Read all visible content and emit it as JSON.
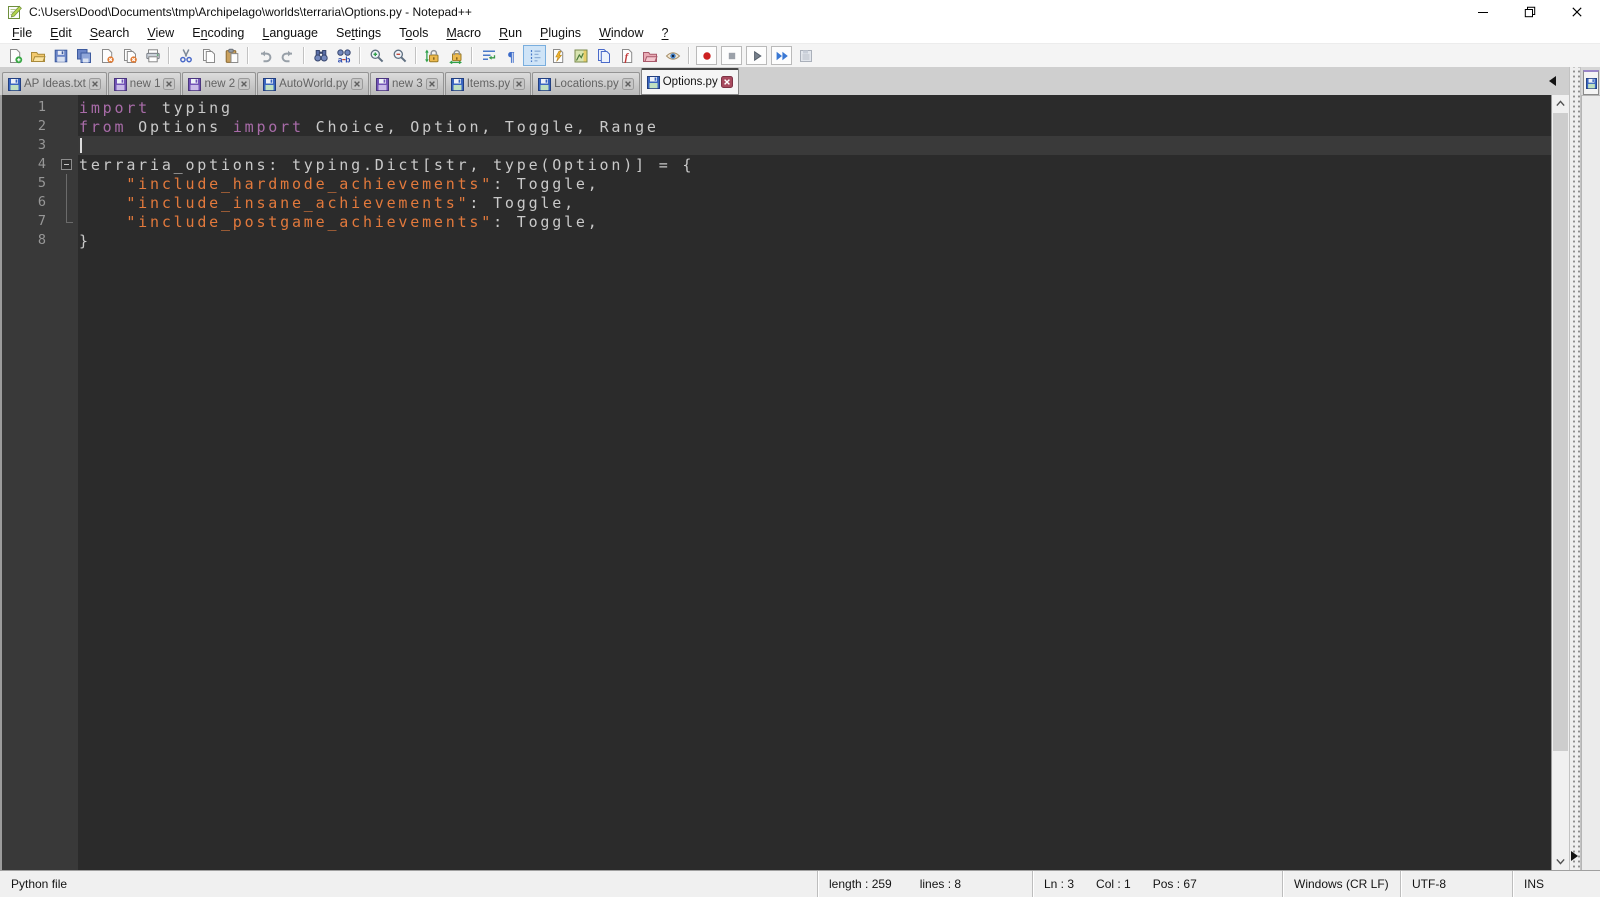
{
  "window": {
    "title": "C:\\Users\\Dood\\Documents\\tmp\\Archipelago\\worlds\\terraria\\Options.py - Notepad++"
  },
  "menu": {
    "items": [
      {
        "label": "File",
        "mnemonic": 0
      },
      {
        "label": "Edit",
        "mnemonic": 0
      },
      {
        "label": "Search",
        "mnemonic": 0
      },
      {
        "label": "View",
        "mnemonic": 0
      },
      {
        "label": "Encoding",
        "mnemonic": 1
      },
      {
        "label": "Language",
        "mnemonic": 0
      },
      {
        "label": "Settings",
        "mnemonic": 2
      },
      {
        "label": "Tools",
        "mnemonic": 1
      },
      {
        "label": "Macro",
        "mnemonic": 0
      },
      {
        "label": "Run",
        "mnemonic": 0
      },
      {
        "label": "Plugins",
        "mnemonic": 0
      },
      {
        "label": "Window",
        "mnemonic": 0
      },
      {
        "label": "?",
        "mnemonic": 0
      }
    ]
  },
  "toolbar": {
    "groups": [
      [
        {
          "name": "new-file"
        },
        {
          "name": "open"
        },
        {
          "name": "save"
        },
        {
          "name": "save-all"
        },
        {
          "name": "close"
        },
        {
          "name": "close-all"
        },
        {
          "name": "print"
        }
      ],
      [
        {
          "name": "cut"
        },
        {
          "name": "copy"
        },
        {
          "name": "paste"
        }
      ],
      [
        {
          "name": "undo"
        },
        {
          "name": "redo"
        }
      ],
      [
        {
          "name": "find"
        },
        {
          "name": "replace"
        }
      ],
      [
        {
          "name": "zoom-in"
        },
        {
          "name": "zoom-out"
        }
      ],
      [
        {
          "name": "sync-vertical-scroll"
        },
        {
          "name": "sync-horizontal-scroll"
        }
      ],
      [
        {
          "name": "word-wrap"
        },
        {
          "name": "show-all-characters"
        },
        {
          "name": "show-indent-guide",
          "active": true
        },
        {
          "name": "define-language"
        },
        {
          "name": "document-map"
        },
        {
          "name": "document-list"
        },
        {
          "name": "function-list"
        },
        {
          "name": "folder-as-workspace"
        },
        {
          "name": "monitoring"
        }
      ],
      [
        {
          "name": "macro-record",
          "boxed": true
        },
        {
          "name": "macro-stop",
          "boxed": true
        },
        {
          "name": "macro-playback",
          "boxed": true
        },
        {
          "name": "macro-run-multiple",
          "boxed": true
        },
        {
          "name": "macro-save"
        }
      ]
    ]
  },
  "tabs": {
    "items": [
      {
        "label": "AP Ideas.txt",
        "state": "saved",
        "active": false
      },
      {
        "label": "new 1",
        "state": "modified",
        "active": false
      },
      {
        "label": "new 2",
        "state": "modified",
        "active": false
      },
      {
        "label": "AutoWorld.py",
        "state": "saved",
        "active": false
      },
      {
        "label": "new 3",
        "state": "modified",
        "active": false
      },
      {
        "label": "Items.py",
        "state": "saved",
        "active": false
      },
      {
        "label": "Locations.py",
        "state": "saved",
        "active": false
      },
      {
        "label": "Options.py",
        "state": "saved",
        "active": true
      }
    ]
  },
  "editor": {
    "language": "Python",
    "caret_line": 3,
    "caret_col": 1,
    "current_line": 3,
    "lines": [
      {
        "num": 1,
        "fold": "",
        "tokens": [
          {
            "text": "import",
            "type": "keyword"
          },
          {
            "text": " typing",
            "type": "default"
          }
        ]
      },
      {
        "num": 2,
        "fold": "",
        "tokens": [
          {
            "text": "from",
            "type": "keyword"
          },
          {
            "text": " Options ",
            "type": "default"
          },
          {
            "text": "import",
            "type": "keyword"
          },
          {
            "text": " Choice, Option, Toggle, Range",
            "type": "default"
          }
        ]
      },
      {
        "num": 3,
        "fold": "",
        "tokens": []
      },
      {
        "num": 4,
        "fold": "collapse-box",
        "tokens": [
          {
            "text": "terraria_options: typing.Dict[str, type(Option)] = {",
            "type": "default"
          }
        ]
      },
      {
        "num": 5,
        "fold": "line",
        "tokens": [
          {
            "text": "    ",
            "type": "default"
          },
          {
            "text": "\"include_hardmode_achievements\"",
            "type": "string"
          },
          {
            "text": ": Toggle,",
            "type": "default"
          }
        ]
      },
      {
        "num": 6,
        "fold": "line",
        "tokens": [
          {
            "text": "    ",
            "type": "default"
          },
          {
            "text": "\"include_insane_achievements\"",
            "type": "string"
          },
          {
            "text": ": Toggle,",
            "type": "default"
          }
        ]
      },
      {
        "num": 7,
        "fold": "corner",
        "tokens": [
          {
            "text": "    ",
            "type": "default"
          },
          {
            "text": "\"include_postgame_achievements\"",
            "type": "string"
          },
          {
            "text": ": Toggle,",
            "type": "default"
          }
        ]
      },
      {
        "num": 8,
        "fold": "",
        "tokens": [
          {
            "text": "}",
            "type": "default"
          }
        ]
      }
    ]
  },
  "second_view": {
    "tab_icon_state": "saved"
  },
  "status": {
    "doc_type": "Python file",
    "length": "length : 259",
    "lines": "lines : 8",
    "ln": "Ln : 3",
    "col": "Col : 1",
    "pos": "Pos : 67",
    "eol": "Windows (CR LF)",
    "encoding": "UTF-8",
    "typing_mode": "INS"
  },
  "colors": {
    "keyword": "#a86ba8",
    "string": "#e2793c",
    "text": "#c9c9c9",
    "editor_bg": "#2b2b2b",
    "margin_bg": "#393939",
    "current_line_bg": "#3a3a3a",
    "saved_tab_icon": "#3a66c0",
    "modified_tab_icon": "#7354b6",
    "active_tab_close": "#a84a5e"
  }
}
